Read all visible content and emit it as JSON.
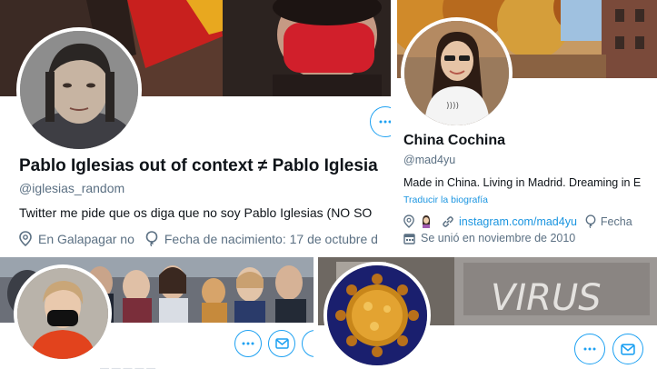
{
  "cards": [
    {
      "name": "Pablo Iglesias out of context ≠ Pablo Iglesia",
      "handle": "@iglesias_random",
      "bio": "Twitter me pide que os diga que no soy Pablo Iglesias (NO SO",
      "location": "En Galapagar no",
      "birthdate": "Fecha de nacimiento: 17 de octubre d"
    },
    {
      "name": "China Cochina",
      "handle": "@mad4yu",
      "bio": "Made in China. Living in Madrid. Dreaming in E",
      "translate": "Traducir la biografía",
      "link": "instagram.com/mad4yu",
      "birthdate_short": "Fecha",
      "joined": "Se unió en noviembre de 2010"
    }
  ],
  "bottom_faded_text": "— — — — —",
  "colors": {
    "accent": "#1da1f2",
    "link": "#1b95e0",
    "secondary": "#5b7083"
  },
  "icons": [
    "location-icon",
    "balloon-icon",
    "link-icon",
    "calendar-icon",
    "more-icon",
    "message-icon",
    "character-icon"
  ]
}
